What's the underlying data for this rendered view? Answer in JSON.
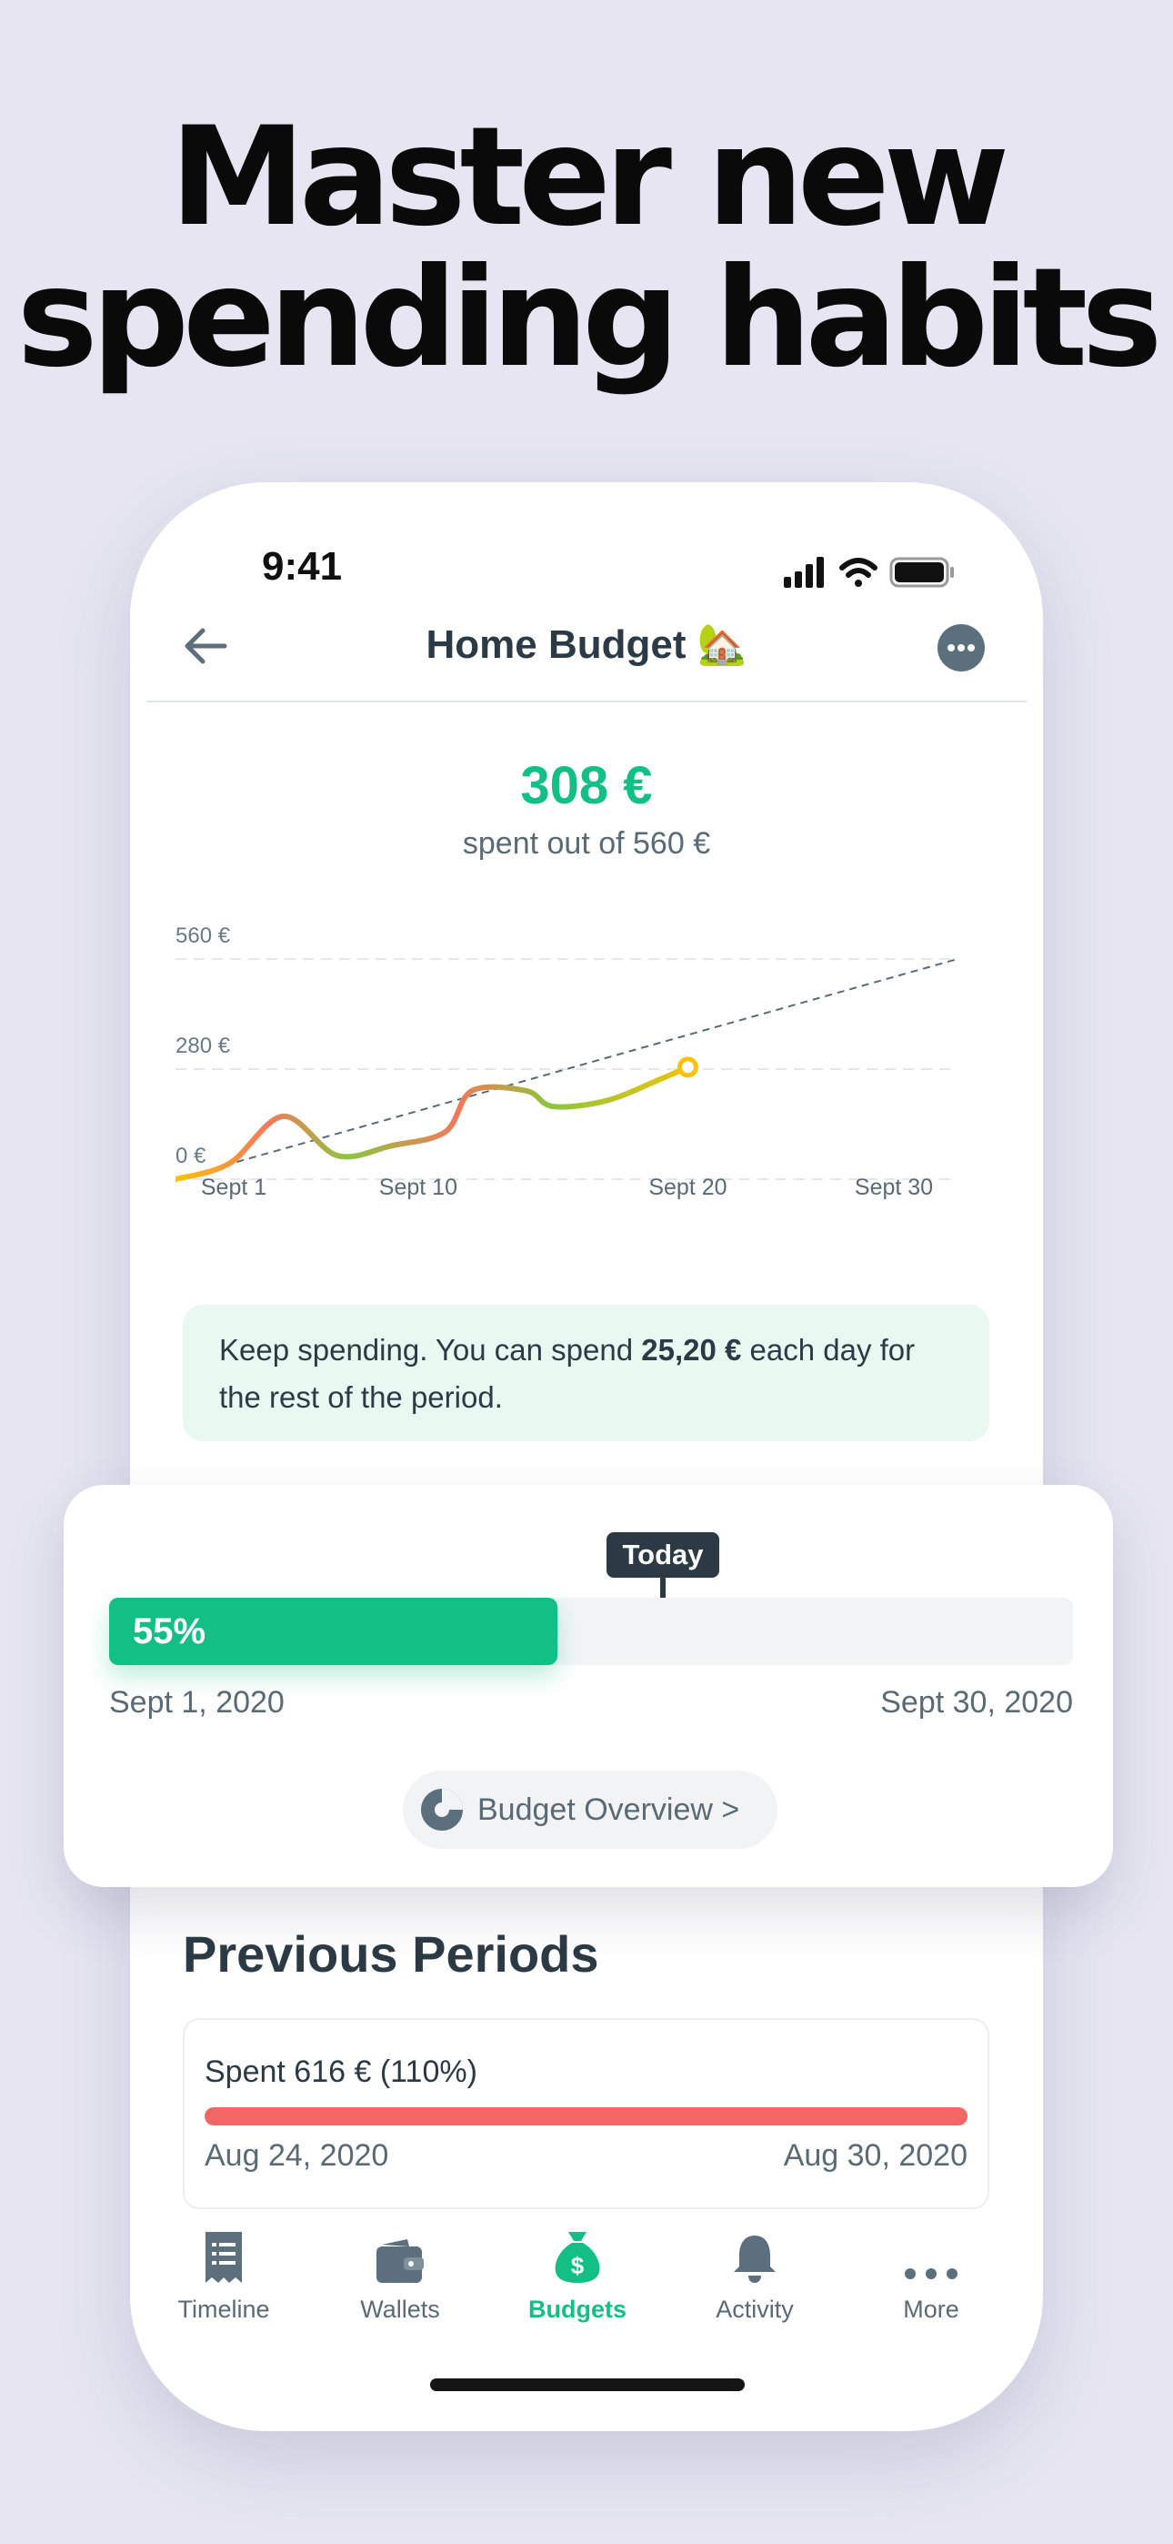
{
  "headline": {
    "line1": "Master new",
    "line2": "spending habits"
  },
  "status_bar": {
    "time": "9:41"
  },
  "nav": {
    "title": "Home Budget 🏡"
  },
  "summary": {
    "spent": "308 €",
    "subtitle": "spent out of 560 €"
  },
  "chart_data": {
    "type": "line",
    "y_ticks": [
      "560 €",
      "280 €",
      "0 €"
    ],
    "x_ticks": [
      "Sept 1",
      "Sept 10",
      "Sept 20",
      "Sept 30"
    ],
    "ylim": [
      0,
      560
    ],
    "xlim": [
      1,
      30
    ],
    "series": [
      {
        "values": [
          [
            1,
            0
          ],
          [
            3,
            40
          ],
          [
            5,
            160
          ],
          [
            7,
            60
          ],
          [
            9,
            85
          ],
          [
            11,
            120
          ],
          [
            12,
            225
          ],
          [
            14,
            225
          ],
          [
            15,
            185
          ],
          [
            17,
            200
          ],
          [
            19,
            255
          ],
          [
            20,
            285
          ]
        ]
      },
      {
        "values": [
          [
            1,
            0
          ],
          [
            30,
            560
          ]
        ]
      }
    ],
    "grid": true,
    "colors": {
      "cool": "#8cc63f",
      "warm": "#f3785c",
      "mid": "#ffc107",
      "target": "#5a6a75"
    }
  },
  "tip": {
    "prefix": "Keep spending. You can spend ",
    "amount": "25,20 €",
    "suffix": " each day for the rest of the period."
  },
  "progress": {
    "today_label": "Today",
    "percent_label": "55%",
    "fraction": 0.465,
    "today_fraction": 0.575,
    "start_date": "Sept 1, 2020",
    "end_date": "Sept 30, 2020",
    "overview_label": "Budget Overview >"
  },
  "previous": {
    "title": "Previous Periods",
    "items": [
      {
        "label": "Spent 616 € (110%)",
        "start": "Aug 24, 2020",
        "end": "Aug 30, 2020",
        "color": "#f26666"
      }
    ]
  },
  "tabs": [
    {
      "label": "Timeline",
      "icon": "receipt-icon"
    },
    {
      "label": "Wallets",
      "icon": "wallet-icon"
    },
    {
      "label": "Budgets",
      "icon": "money-bag-icon",
      "active": true
    },
    {
      "label": "Activity",
      "icon": "bell-icon"
    },
    {
      "label": "More",
      "icon": "ellipsis-icon"
    }
  ],
  "colors": {
    "accent": "#14bf85",
    "text": "#2b3a44",
    "muted": "#5a6a75",
    "over_budget": "#f26666"
  }
}
